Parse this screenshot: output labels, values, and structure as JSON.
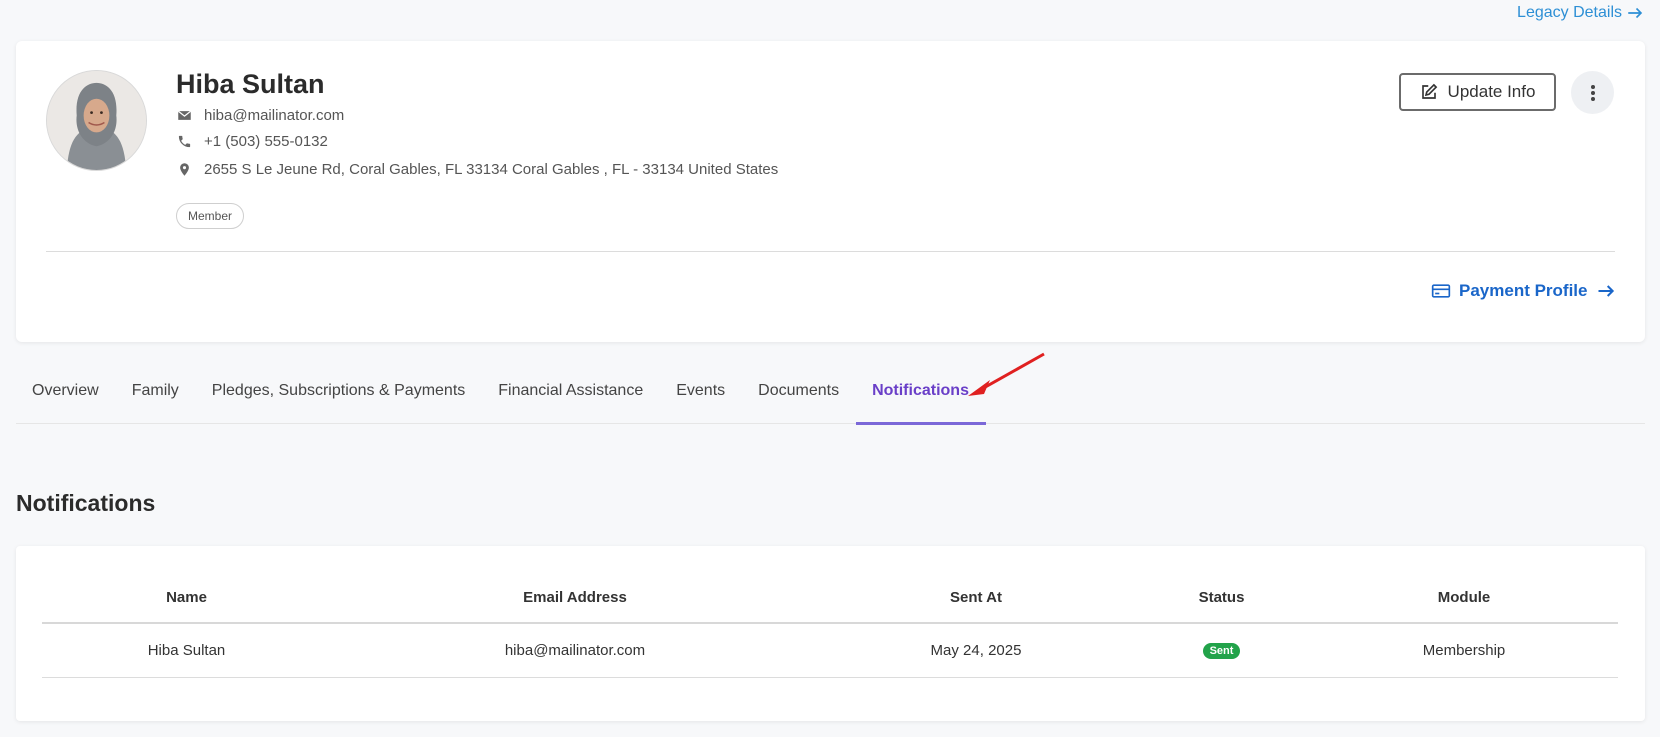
{
  "header": {
    "legacy_label": "Legacy Details"
  },
  "profile": {
    "name": "Hiba Sultan",
    "email": "hiba@mailinator.com",
    "phone": "+1 (503) 555-0132",
    "address": "2655 S Le Jeune Rd, Coral Gables, FL 33134 Coral Gables , FL - 33134 United States",
    "role_badge": "Member",
    "update_label": "Update Info",
    "payment_label": "Payment Profile"
  },
  "tabs": [
    {
      "label": "Overview",
      "active": false
    },
    {
      "label": "Family",
      "active": false
    },
    {
      "label": "Pledges, Subscriptions & Payments",
      "active": false
    },
    {
      "label": "Financial Assistance",
      "active": false
    },
    {
      "label": "Events",
      "active": false
    },
    {
      "label": "Documents",
      "active": false
    },
    {
      "label": "Notifications",
      "active": true
    }
  ],
  "notifications": {
    "title": "Notifications",
    "columns": [
      "Name",
      "Email Address",
      "Sent At",
      "Status",
      "Module"
    ],
    "rows": [
      {
        "name": "Hiba Sultan",
        "email": "hiba@mailinator.com",
        "sent_at": "May 24, 2025",
        "status": "Sent",
        "module": "Membership"
      }
    ]
  },
  "colors": {
    "accent_tab": "#6a3fc8",
    "link_blue": "#1a66c9",
    "status_sent": "#22a34a",
    "annotation_arrow": "#e02020"
  }
}
